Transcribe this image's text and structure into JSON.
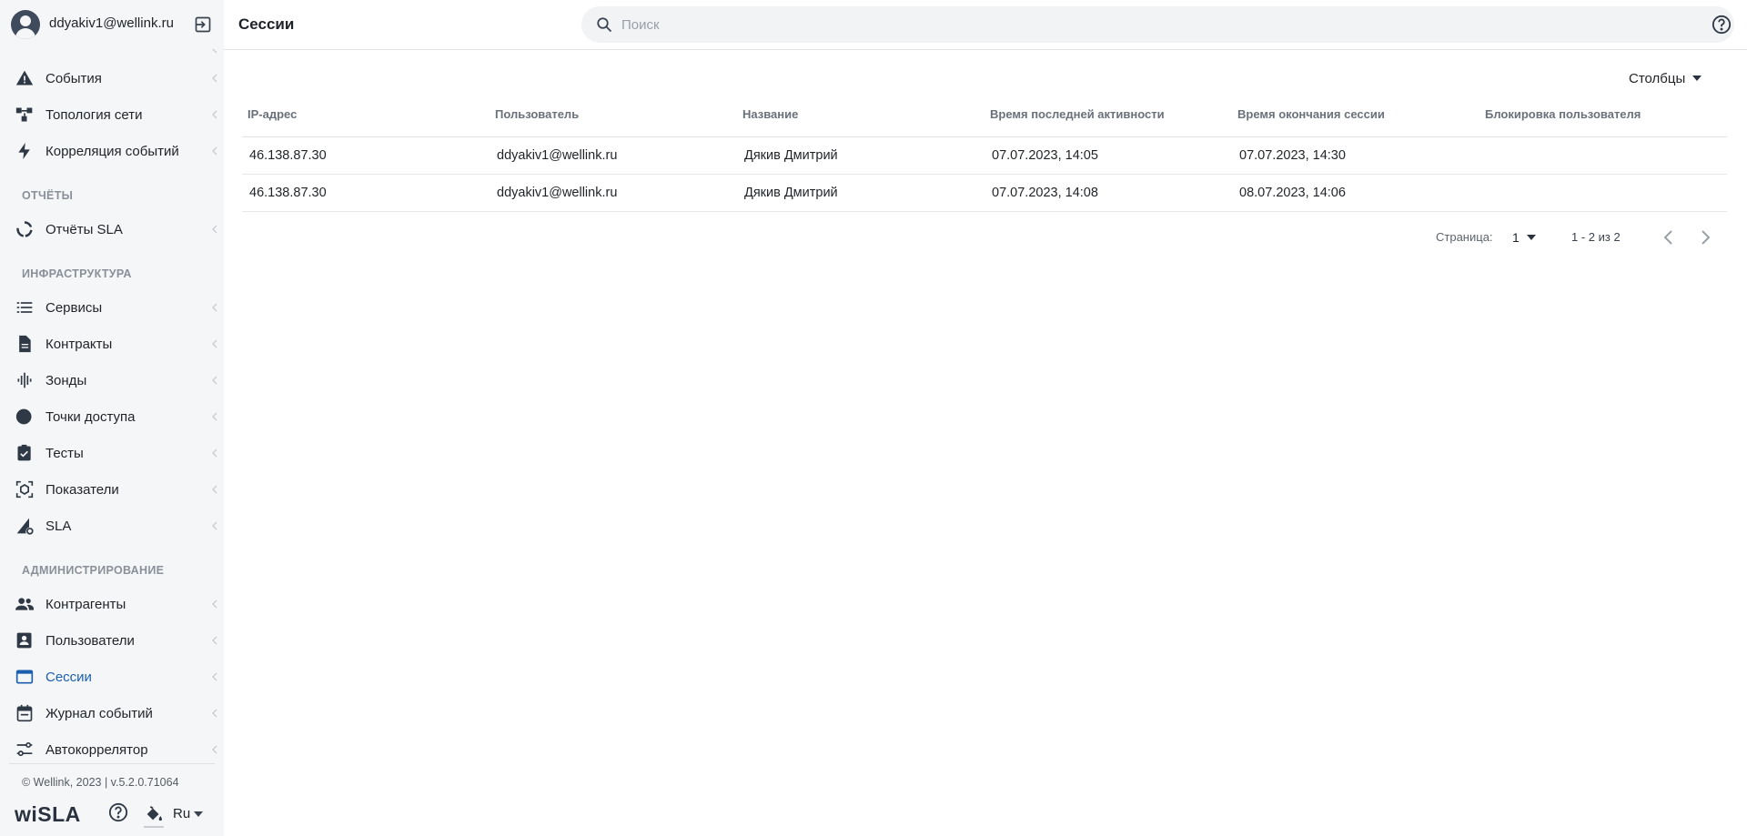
{
  "user": {
    "email": "ddyakiv1@wellink.ru"
  },
  "header": {
    "title": "Сессии"
  },
  "search": {
    "placeholder": "Поиск",
    "value": ""
  },
  "sidebar": {
    "items": [
      {
        "label": "События",
        "icon": "warning-icon"
      },
      {
        "label": "Топология сети",
        "icon": "topology-icon"
      },
      {
        "label": "Корреляция событий",
        "icon": "lightning-icon"
      },
      {
        "label": "Отчёты SLA",
        "icon": "donut-icon"
      },
      {
        "label": "Сервисы",
        "icon": "list-icon"
      },
      {
        "label": "Контракты",
        "icon": "document-icon"
      },
      {
        "label": "Зонды",
        "icon": "waveform-icon"
      },
      {
        "label": "Точки доступа",
        "icon": "circle-icon"
      },
      {
        "label": "Тесты",
        "icon": "clipboard-check-icon"
      },
      {
        "label": "Показатели",
        "icon": "metrics-icon"
      },
      {
        "label": "SLA",
        "icon": "sla-gear-icon"
      },
      {
        "label": "Контрагенты",
        "icon": "people-icon"
      },
      {
        "label": "Пользователи",
        "icon": "user-card-icon"
      },
      {
        "label": "Сессии",
        "icon": "browser-window-icon"
      },
      {
        "label": "Журнал событий",
        "icon": "calendar-icon"
      },
      {
        "label": "Автокоррелятор",
        "icon": "sliders-icon"
      }
    ],
    "sections": {
      "reports": "ОТЧЁТЫ",
      "infrastructure": "ИНФРАСТРУКТУРА",
      "administration": "АДМИНИСТРИРОВАНИЕ"
    },
    "active_color": "#1b5fae"
  },
  "footer": {
    "copyright": "© Wellink, 2023 | v.5.2.0.71064",
    "logo": "wiSLA",
    "language": "Ru"
  },
  "table": {
    "columns_button": "Столбцы",
    "headers": [
      "IP-адрес",
      "Пользователь",
      "Название",
      "Время последней активности",
      "Время окончания сессии",
      "Блокировка пользователя"
    ],
    "rows": [
      [
        "46.138.87.30",
        "ddyakiv1@wellink.ru",
        "Дякив Дмитрий",
        "07.07.2023, 14:05",
        "07.07.2023, 14:30",
        ""
      ],
      [
        "46.138.87.30",
        "ddyakiv1@wellink.ru",
        "Дякив Дмитрий",
        "07.07.2023, 14:08",
        "08.07.2023, 14:06",
        ""
      ]
    ]
  },
  "pagination": {
    "label": "Страница:",
    "page": "1",
    "range": "1 - 2 из 2"
  }
}
